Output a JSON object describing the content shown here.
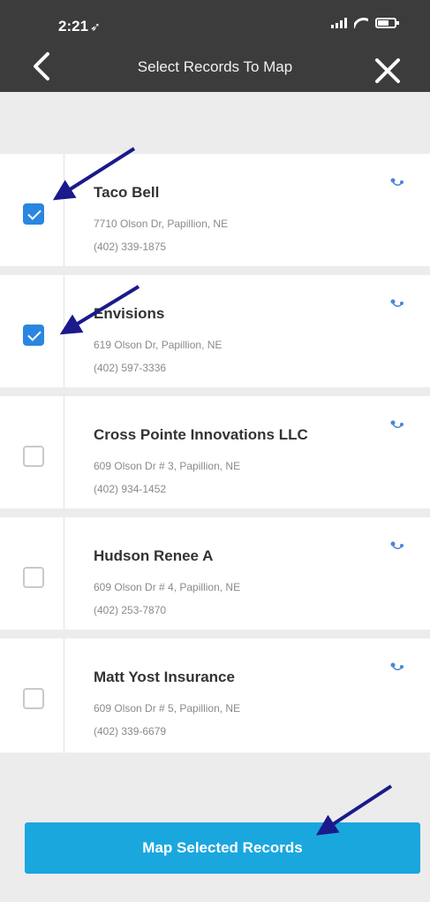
{
  "status": {
    "time": "2:21"
  },
  "nav": {
    "title": "Select Records To Map"
  },
  "records": [
    {
      "name": "Taco Bell",
      "address": "7710 Olson Dr, Papillion, NE",
      "phone": "(402) 339-1875",
      "checked": true
    },
    {
      "name": "Envisions",
      "address": "619 Olson Dr, Papillion, NE",
      "phone": "(402) 597-3336",
      "checked": true
    },
    {
      "name": "Cross Pointe Innovations LLC",
      "address": "609 Olson Dr # 3, Papillion, NE",
      "phone": "(402) 934-1452",
      "checked": false
    },
    {
      "name": "Hudson Renee A",
      "address": "609 Olson Dr # 4, Papillion, NE",
      "phone": "(402) 253-7870",
      "checked": false
    },
    {
      "name": "Matt Yost Insurance",
      "address": "609 Olson Dr # 5, Papillion, NE",
      "phone": "(402) 339-6679",
      "checked": false
    }
  ],
  "footer": {
    "button_label": "Map Selected Records"
  },
  "colors": {
    "header": "#3c3c3c",
    "checkbox_checked": "#2a86e0",
    "button": "#1aa7de",
    "annotation_arrow": "#1a1a8c"
  },
  "icons": {
    "back": "chevron-left-icon",
    "close": "close-icon",
    "route": "route-icon"
  }
}
